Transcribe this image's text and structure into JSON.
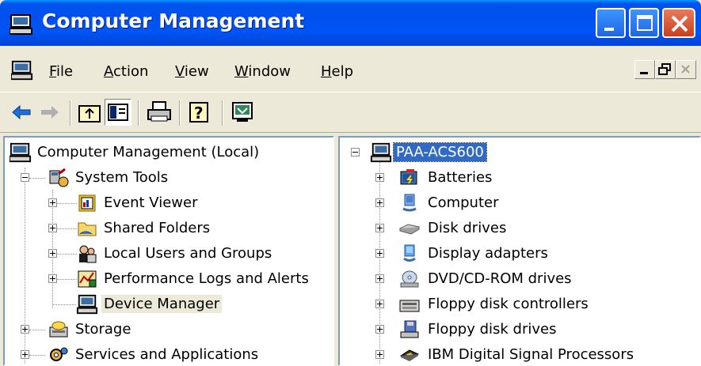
{
  "window": {
    "title": "Computer Management",
    "accent": "#0054E3",
    "close_color": "#D5492B"
  },
  "menu": {
    "items": [
      {
        "label_u": "F",
        "label_rest": "ile"
      },
      {
        "label_u": "A",
        "label_rest": "ction"
      },
      {
        "label_u": "V",
        "label_rest": "iew"
      },
      {
        "label_u": "W",
        "label_rest": "indow"
      },
      {
        "label_u": "H",
        "label_rest": "elp"
      }
    ]
  },
  "toolbar": {
    "buttons": [
      "back-arrow-icon",
      "forward-arrow-icon",
      "up-folder-icon",
      "show-hide-tree-icon",
      "print-icon",
      "help-icon",
      "properties-icon"
    ]
  },
  "left_tree": {
    "root": "Computer Management (Local)",
    "system_tools": "System Tools",
    "children": [
      "Event Viewer",
      "Shared Folders",
      "Local Users and Groups",
      "Performance Logs and Alerts",
      "Device Manager"
    ],
    "storage": "Storage",
    "services": "Services and Applications"
  },
  "right_tree": {
    "root": "PAA-ACS600",
    "items": [
      "Batteries",
      "Computer",
      "Disk drives",
      "Display adapters",
      "DVD/CD-ROM drives",
      "Floppy disk controllers",
      "Floppy disk drives",
      "IBM Digital Signal Processors"
    ]
  }
}
